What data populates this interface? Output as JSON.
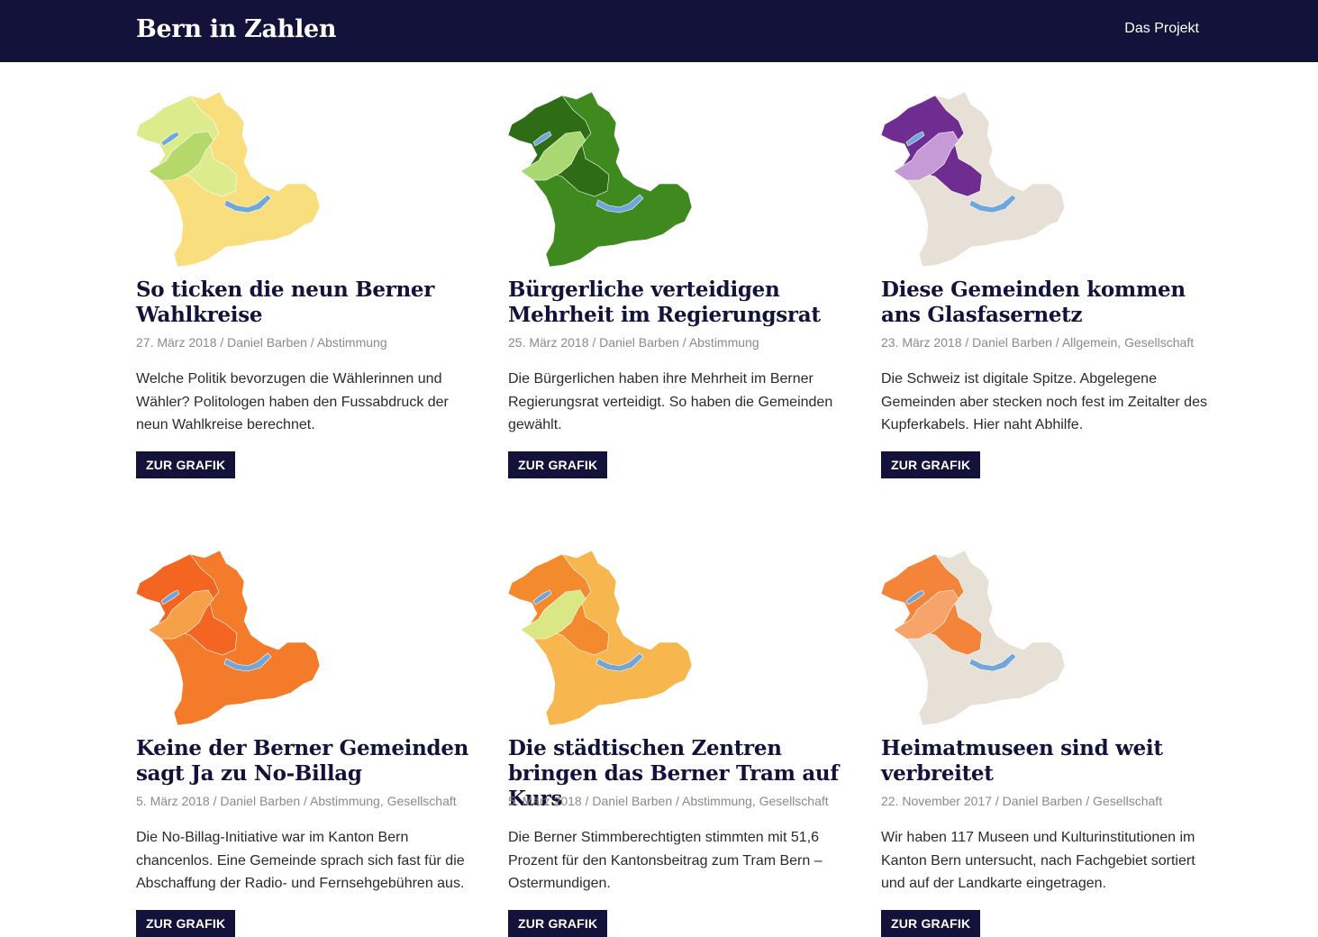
{
  "header": {
    "site_title": "Bern in Zahlen",
    "nav_project": "Das Projekt"
  },
  "posts": [
    {
      "title": "So ticken die neun Berner Wahlkreise",
      "date": "27. März 2018",
      "author": "Daniel Barben",
      "categories": [
        "Abstimmung"
      ],
      "excerpt": "Welche Politik bevorzugen die Wählerinnen und Wähler? Politologen haben den Fussabdruck der neun Wahlkreise berechnet.",
      "button": "ZUR GRAFIK",
      "map_colors": {
        "main": "#f9de7e",
        "second": "#dcec8d",
        "third": "#b4d86a",
        "lakes": "#6fa7dc"
      }
    },
    {
      "title": "Bürgerliche verteidigen Mehrheit im Regierungsrat",
      "date": "25. März 2018",
      "author": "Daniel Barben",
      "categories": [
        "Abstimmung"
      ],
      "excerpt": "Die Bürgerlichen haben ihre Mehrheit im Berner Regierungsrat verteidigt. So haben die Gemeinden gewählt.",
      "button": "ZUR GRAFIK",
      "map_colors": {
        "main": "#3f8a1f",
        "second": "#2f6c16",
        "third": "#a9d872",
        "lakes": "#6fa7dc"
      }
    },
    {
      "title": "Diese Gemeinden kommen ans Glasfasernetz",
      "date": "23. März 2018",
      "author": "Daniel Barben",
      "categories": [
        "Allgemein",
        "Gesellschaft"
      ],
      "excerpt": "Die Schweiz ist digitale Spitze. Abgelegene Gemeinden aber stecken noch fest im Zeitalter des Kupferkabels. Hier naht Abhilfe.",
      "button": "ZUR GRAFIK",
      "map_colors": {
        "main": "#e6e0d6",
        "second": "#6f2c91",
        "third": "#c49bd6",
        "lakes": "#6fa7dc"
      }
    },
    {
      "title": "Keine der Berner Gemeinden sagt Ja zu No-Billag",
      "date": "5. März 2018",
      "author": "Daniel Barben",
      "categories": [
        "Abstimmung",
        "Gesellschaft"
      ],
      "excerpt": "Die No-Billag-Initiative war im Kanton Bern chancenlos. Eine Gemeinde sprach sich fast für die Abschaffung der Radio- und Fernsehgebühren aus.",
      "button": "ZUR GRAFIK",
      "map_colors": {
        "main": "#f47b2a",
        "second": "#f36520",
        "third": "#f7a04a",
        "lakes": "#6fa7dc"
      }
    },
    {
      "title": "Die städtischen Zentren bringen das Berner Tram auf Kurs",
      "date": "5. März 2018",
      "author": "Daniel Barben",
      "categories": [
        "Abstimmung",
        "Gesellschaft"
      ],
      "excerpt": "Die Berner Stimmberechtigten stimmten mit 51,6 Prozent für den Kantonsbeitrag zum Tram Bern – Ostermundigen.",
      "button": "ZUR GRAFIK",
      "map_colors": {
        "main": "#f8b64e",
        "second": "#f38a2e",
        "third": "#d9e885",
        "lakes": "#6fa7dc"
      }
    },
    {
      "title": "Heimatmuseen sind weit verbreitet",
      "date": "22. November 2017",
      "author": "Daniel Barben",
      "categories": [
        "Gesellschaft"
      ],
      "excerpt": "Wir haben 117 Museen und Kulturinstitutionen im Kanton Bern untersucht, nach Fachgebiet sortiert und auf der Landkarte eingetragen.",
      "button": "ZUR GRAFIK",
      "map_colors": {
        "main": "#e6e0d6",
        "second": "#f3843a",
        "third": "#f7a46a",
        "lakes": "#6fa7dc"
      }
    }
  ]
}
